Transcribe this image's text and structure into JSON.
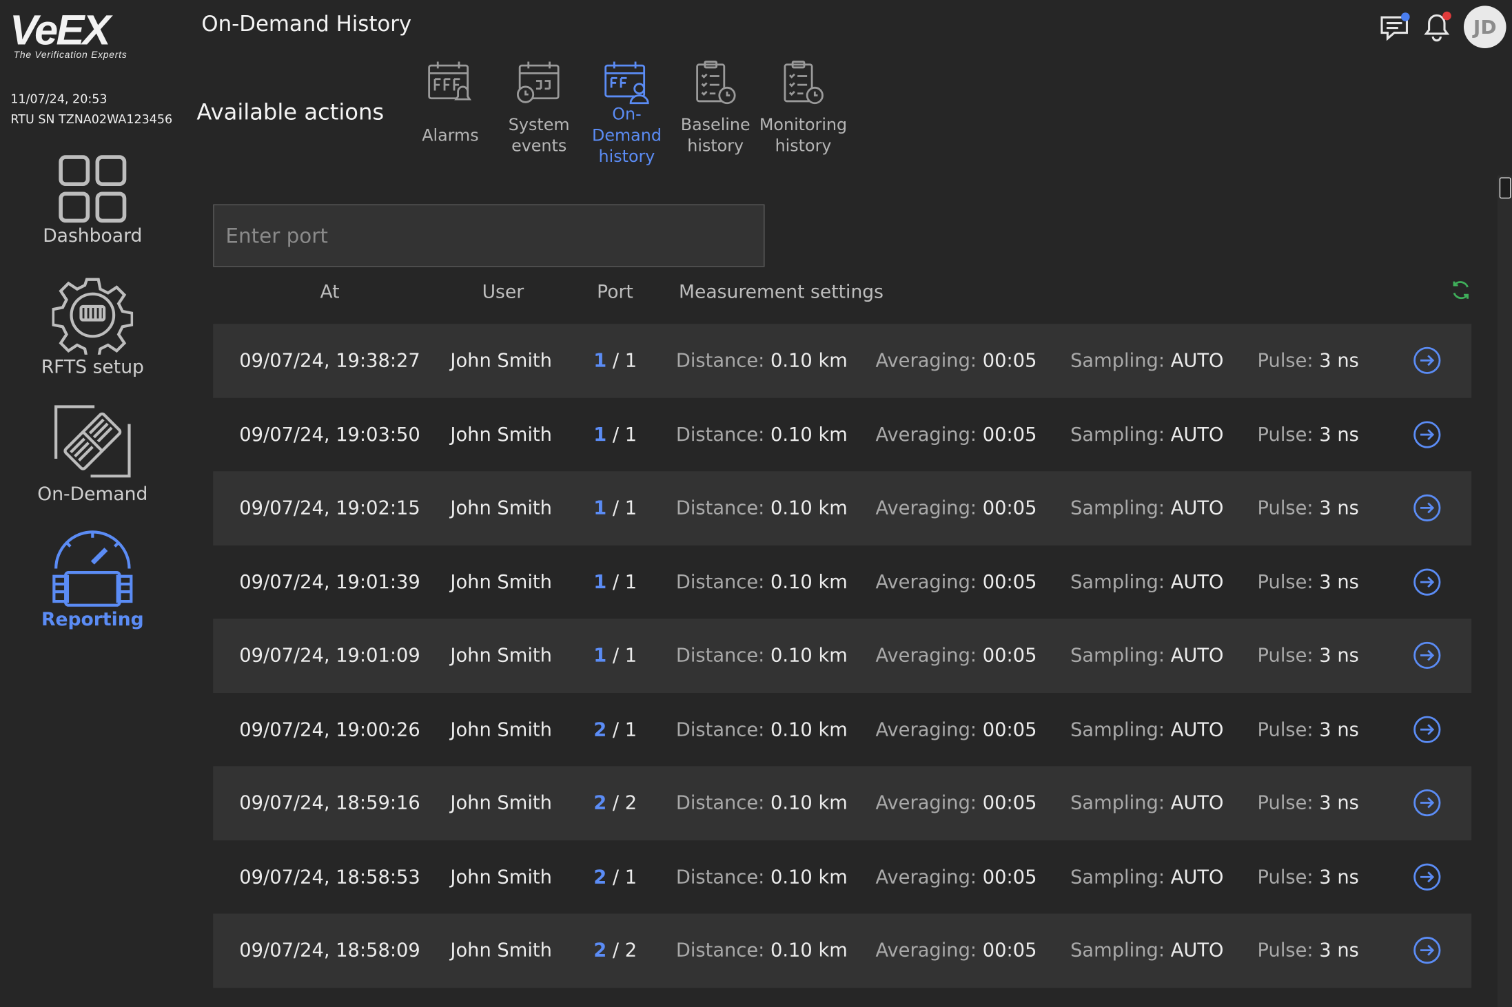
{
  "brand": {
    "logo_text": "VeEX",
    "tagline": "The Verification Experts"
  },
  "device": {
    "datetime": "11/07/24, 20:53",
    "serial": "RTU SN TZNA02WA123456"
  },
  "sidebar": {
    "items": [
      {
        "label": "Dashboard",
        "icon": "dashboard-grid-icon",
        "active": false
      },
      {
        "label": "RFTS setup",
        "icon": "gear-icon",
        "active": false
      },
      {
        "label": "On-Demand",
        "icon": "on-demand-plug-icon",
        "active": false
      },
      {
        "label": "Reporting",
        "icon": "gauge-icon",
        "active": true
      }
    ]
  },
  "header": {
    "title": "On-Demand History",
    "avatar_initials": "JD",
    "icons": [
      "chat-icon",
      "bell-icon"
    ]
  },
  "actions": {
    "heading": "Available actions",
    "items": [
      {
        "label": "Alarms",
        "icon": "calendar-bell-icon",
        "active": false
      },
      {
        "label": "System events",
        "icon": "calendar-clock-icon",
        "active": false
      },
      {
        "label": "On-Demand history",
        "icon": "calendar-user-icon",
        "active": true
      },
      {
        "label": "Baseline history",
        "icon": "clipboard-clock-icon",
        "active": false
      },
      {
        "label": "Monitoring history",
        "icon": "clipboard-clock-icon",
        "active": false
      }
    ]
  },
  "search": {
    "placeholder": "Enter port",
    "value": ""
  },
  "table": {
    "columns": {
      "at": "At",
      "user": "User",
      "port": "Port",
      "settings": "Measurement settings"
    },
    "labels": {
      "distance": "Distance:",
      "averaging": "Averaging:",
      "sampling": "Sampling:",
      "pulse": "Pulse:"
    },
    "rows": [
      {
        "at": "09/07/24, 19:38:27",
        "user": "John Smith",
        "port_a": "1",
        "port_b": "1",
        "distance": "0.10 km",
        "averaging": "00:05",
        "sampling": "AUTO",
        "pulse": "3 ns"
      },
      {
        "at": "09/07/24, 19:03:50",
        "user": "John Smith",
        "port_a": "1",
        "port_b": "1",
        "distance": "0.10 km",
        "averaging": "00:05",
        "sampling": "AUTO",
        "pulse": "3 ns"
      },
      {
        "at": "09/07/24, 19:02:15",
        "user": "John Smith",
        "port_a": "1",
        "port_b": "1",
        "distance": "0.10 km",
        "averaging": "00:05",
        "sampling": "AUTO",
        "pulse": "3 ns"
      },
      {
        "at": "09/07/24, 19:01:39",
        "user": "John Smith",
        "port_a": "1",
        "port_b": "1",
        "distance": "0.10 km",
        "averaging": "00:05",
        "sampling": "AUTO",
        "pulse": "3 ns"
      },
      {
        "at": "09/07/24, 19:01:09",
        "user": "John Smith",
        "port_a": "1",
        "port_b": "1",
        "distance": "0.10 km",
        "averaging": "00:05",
        "sampling": "AUTO",
        "pulse": "3 ns"
      },
      {
        "at": "09/07/24, 19:00:26",
        "user": "John Smith",
        "port_a": "2",
        "port_b": "1",
        "distance": "0.10 km",
        "averaging": "00:05",
        "sampling": "AUTO",
        "pulse": "3 ns"
      },
      {
        "at": "09/07/24, 18:59:16",
        "user": "John Smith",
        "port_a": "2",
        "port_b": "2",
        "distance": "0.10 km",
        "averaging": "00:05",
        "sampling": "AUTO",
        "pulse": "3 ns"
      },
      {
        "at": "09/07/24, 18:58:53",
        "user": "John Smith",
        "port_a": "2",
        "port_b": "1",
        "distance": "0.10 km",
        "averaging": "00:05",
        "sampling": "AUTO",
        "pulse": "3 ns"
      },
      {
        "at": "09/07/24, 18:58:09",
        "user": "John Smith",
        "port_a": "2",
        "port_b": "2",
        "distance": "0.10 km",
        "averaging": "00:05",
        "sampling": "AUTO",
        "pulse": "3 ns"
      }
    ]
  },
  "colors": {
    "background": "#262626",
    "row_stripe": "#333333",
    "accent": "#5b8cf5",
    "refresh_green": "#3fae5a",
    "chat_dot": "#4a7ef0",
    "bell_dot": "#e03b3b"
  }
}
